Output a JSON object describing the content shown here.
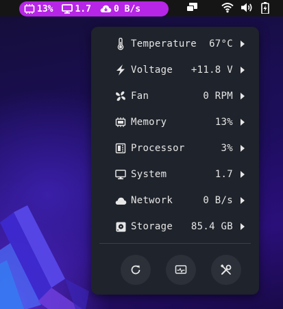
{
  "topbar": {
    "indicator": {
      "memory": "13%",
      "system": "1.7",
      "network": "0 B/s"
    }
  },
  "menu": {
    "items": [
      {
        "label": "Temperature",
        "value": "67°C",
        "icon": "thermometer-icon"
      },
      {
        "label": "Voltage",
        "value": "+11.8 V",
        "icon": "lightning-icon"
      },
      {
        "label": "Fan",
        "value": "0 RPM",
        "icon": "fan-icon"
      },
      {
        "label": "Memory",
        "value": "13%",
        "icon": "memory-chip-icon"
      },
      {
        "label": "Processor",
        "value": "3%",
        "icon": "processor-icon"
      },
      {
        "label": "System",
        "value": "1.7",
        "icon": "monitor-icon"
      },
      {
        "label": "Network",
        "value": "0 B/s",
        "icon": "cloud-icon"
      },
      {
        "label": "Storage",
        "value": "85.4 GB",
        "icon": "disk-icon"
      }
    ],
    "actions": [
      "refresh-icon",
      "system-monitor-icon",
      "preferences-icon"
    ]
  },
  "colors": {
    "accent": "#b726e6",
    "menu_bg": "#1f232b",
    "text": "#e6e6e6"
  }
}
